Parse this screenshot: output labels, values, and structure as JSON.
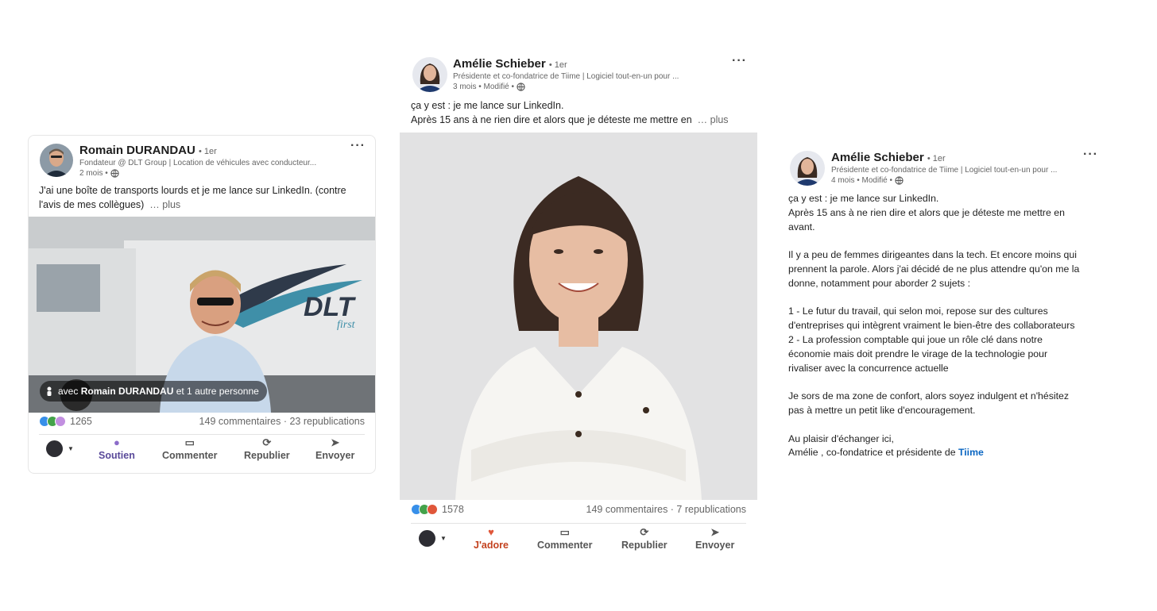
{
  "post1": {
    "author": "Romain DURANDAU",
    "degree": "• 1er",
    "headline": "Fondateur @ DLT Group | Location de véhicules avec conducteur...",
    "time": "2 mois •",
    "text_line1": "J'ai une boîte de transports lourds et je me lance sur LinkedIn. (contre",
    "text_line2": "l'avis de mes collègues)",
    "more": "… plus",
    "tag_prefix": "avec",
    "tag_name": "Romain DURANDAU",
    "tag_suffix": "et 1 autre personne",
    "truck_brand": "DLT",
    "truck_sub": "first",
    "reactions": "1265",
    "comments": "149 commentaires · 23 republications",
    "actions": [
      "Soutien",
      "Commenter",
      "Republier",
      "Envoyer"
    ]
  },
  "post2": {
    "author": "Amélie Schieber",
    "degree": "• 1er",
    "headline": "Présidente et co-fondatrice de Tiime | Logiciel tout-en-un pour ...",
    "time": "3 mois • Modifié •",
    "text_line1": "ça y est : je me lance sur LinkedIn.",
    "text_line2": "Après 15 ans à ne rien dire et alors que je déteste me mettre en",
    "more": "… plus",
    "reactions": "1578",
    "comments": "149 commentaires · 7 republications",
    "actions": [
      "J'adore",
      "Commenter",
      "Republier",
      "Envoyer"
    ]
  },
  "post3": {
    "author": "Amélie Schieber",
    "degree": "• 1er",
    "headline": "Présidente et co-fondatrice de Tiime | Logiciel tout-en-un pour ...",
    "time": "4 mois • Modifié •",
    "paragraphs": [
      [
        "ça y est : je me lance sur LinkedIn.",
        "Après 15 ans à ne rien dire et alors que je déteste me mettre en",
        "avant."
      ],
      [
        "Il y a peu de femmes dirigeantes dans la tech. Et encore moins qui",
        "prennent la parole. Alors j'ai décidé de ne plus attendre qu'on me la",
        "donne, notamment pour aborder 2 sujets :"
      ],
      [
        "1 - Le futur du travail, qui selon moi, repose sur des cultures",
        "d'entreprises qui intègrent vraiment le bien-être des collaborateurs",
        "2 - La profession comptable qui joue un rôle clé dans notre",
        "économie mais doit prendre le virage de la technologie pour",
        "rivaliser avec la concurrence actuelle"
      ],
      [
        "Je sors de ma zone de confort, alors soyez indulgent et n'hésitez",
        "pas à mettre un petit like d'encouragement."
      ],
      [
        "Au plaisir d'échanger ici,"
      ]
    ],
    "sign_prefix": "Amélie , co-fondatrice et présidente de ",
    "sign_link": "Tiime"
  },
  "colors": {
    "link": "#0a66c2",
    "like": "#378fe9",
    "celebrate": "#44a24a",
    "love": "#e0573a",
    "support": "#8c6cc9"
  },
  "icons": [
    "globe-icon",
    "more-options-icon",
    "comment-icon",
    "repost-icon",
    "send-icon",
    "support-icon",
    "love-icon",
    "caret-down-icon",
    "person-tag-icon"
  ]
}
